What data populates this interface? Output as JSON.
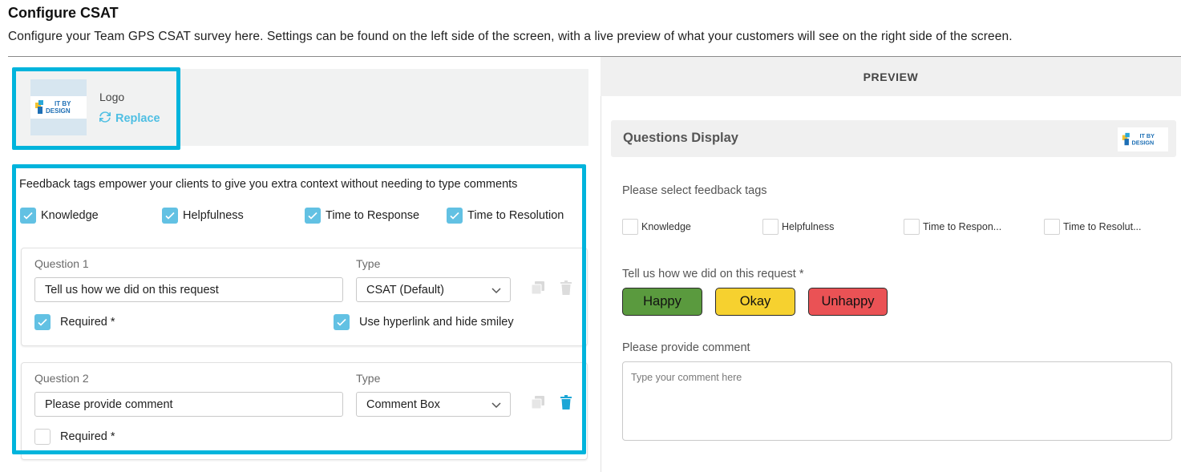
{
  "header": {
    "title": "Configure CSAT",
    "description": "Configure your Team GPS CSAT survey here. Settings can be found on the left side of the screen, with a live preview of what your customers will see on the right side of the screen."
  },
  "logo_section": {
    "logo_text_line1": "IT BY",
    "logo_text_line2": "DESIGN",
    "label": "Logo",
    "replace_label": "Replace"
  },
  "feedback_tags": {
    "intro": "Feedback tags empower your clients to give you extra context without needing to type comments",
    "tags": [
      {
        "label": "Knowledge",
        "checked": true
      },
      {
        "label": "Helpfulness",
        "checked": true
      },
      {
        "label": "Time to Response",
        "checked": true
      },
      {
        "label": "Time to Resolution",
        "checked": true
      }
    ]
  },
  "questions": [
    {
      "title": "Question 1",
      "type_label": "Type",
      "text": "Tell us how we did on this request",
      "type_value": "CSAT (Default)",
      "required_label": "Required *",
      "required": true,
      "hyperlink_label": "Use hyperlink and hide smiley",
      "hyperlink": true
    },
    {
      "title": "Question 2",
      "type_label": "Type",
      "text": "Please provide comment",
      "type_value": "Comment Box",
      "required_label": "Required *",
      "required": false
    }
  ],
  "preview": {
    "header": "PREVIEW",
    "display_title": "Questions Display",
    "tags_prompt": "Please select feedback tags",
    "tags": [
      "Knowledge",
      "Helpfulness",
      "Time to Respon...",
      "Time to Resolut..."
    ],
    "question1": "Tell us how we did on this request *",
    "buttons": [
      {
        "label": "Happy",
        "color": "#5a9a3e"
      },
      {
        "label": "Okay",
        "color": "#f6d12f"
      },
      {
        "label": "Unhappy",
        "color": "#ea5255"
      }
    ],
    "question2": "Please provide comment",
    "comment_placeholder": "Type your comment here"
  },
  "colors": {
    "highlight": "#00b4dc",
    "checkbox": "#62c1e3",
    "delete_active": "#1ba6d6"
  }
}
